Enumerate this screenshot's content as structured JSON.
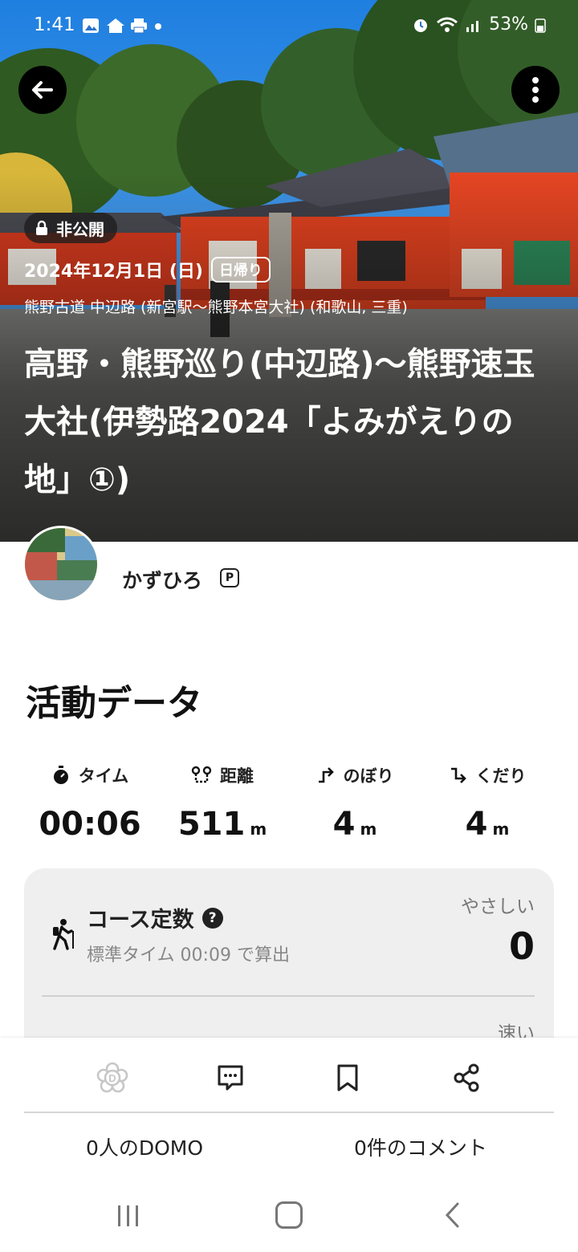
{
  "status_bar": {
    "time": "1:41",
    "battery": "53%"
  },
  "activity": {
    "visibility": "非公開",
    "date": "2024年12月1日 (日)",
    "trip_type": "日帰り",
    "location": "熊野古道 中辺路 (新宮駅～熊野本宮大社) (和歌山, 三重)",
    "title": "高野・熊野巡り(中辺路)～熊野速玉大社(伊勢路2024「よみがえりの地」①)"
  },
  "author": {
    "name": "かずひろ",
    "badge": "P"
  },
  "activity_data": {
    "section_title": "活動データ",
    "stats": {
      "time": {
        "label": "タイム",
        "value": "00:06",
        "unit": ""
      },
      "distance": {
        "label": "距離",
        "value": "511",
        "unit": "m"
      },
      "ascent": {
        "label": "のぼり",
        "value": "4",
        "unit": "m"
      },
      "descent": {
        "label": "くだり",
        "value": "4",
        "unit": "m"
      }
    },
    "course_constant": {
      "title": "コース定数",
      "help": "?",
      "subtitle": "標準タイム 00:09 で算出",
      "level": "やさしい",
      "value": "0"
    },
    "pace": {
      "level": "速い"
    }
  },
  "actions": {
    "domo_count": "0人のDOMO",
    "comment_count": "0件のコメント"
  },
  "colors": {
    "card_bg": "#efefef",
    "text": "#1a1a1a",
    "muted": "#888888"
  }
}
